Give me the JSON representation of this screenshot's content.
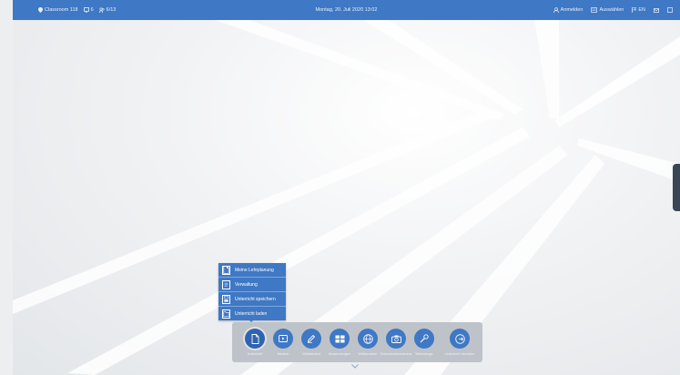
{
  "topbar": {
    "room": "Classroom 118",
    "screen_count": "6",
    "user_count": "6/13",
    "datetime": "Montag, 20. Juli 2020 13:02",
    "login": "Anmelden",
    "select": "Auswählen",
    "language": "EN"
  },
  "menu": {
    "items": [
      {
        "label": "Meine Lehrplanung",
        "icon": "document-icon"
      },
      {
        "label": "Verwaltung",
        "icon": "document-list-icon"
      },
      {
        "label": "Unterricht speichern",
        "icon": "save-icon"
      },
      {
        "label": "Unterricht laden",
        "icon": "folder-icon"
      }
    ]
  },
  "dock": {
    "items": [
      {
        "label": "Unterricht",
        "icon": "document-icon"
      },
      {
        "label": "Medien",
        "icon": "media-icon"
      },
      {
        "label": "Whiteboard",
        "icon": "pen-icon"
      },
      {
        "label": "Anwendungen",
        "icon": "apps-icon"
      },
      {
        "label": "Webbrowser",
        "icon": "globe-icon"
      },
      {
        "label": "Dokumentenkamera",
        "icon": "camera-icon"
      },
      {
        "label": "Werkzeuge",
        "icon": "wrench-icon"
      },
      {
        "label": "Unterricht beenden",
        "icon": "exit-icon"
      }
    ]
  },
  "colors": {
    "accent": "#3f78c4",
    "dock_bg": "#bec3c9",
    "handle": "#3a4555"
  }
}
